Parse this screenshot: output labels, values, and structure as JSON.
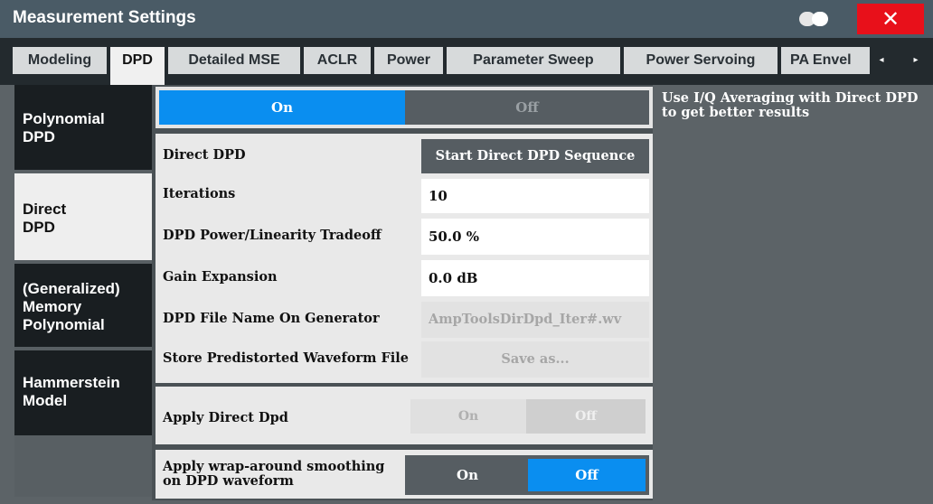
{
  "window": {
    "title": "Measurement Settings",
    "close_label": "✕",
    "toggle_icon": "display-toggle-icon"
  },
  "tabs": [
    {
      "label": "Modeling",
      "active": false
    },
    {
      "label": "DPD",
      "active": true
    },
    {
      "label": "Detailed MSE",
      "active": false
    },
    {
      "label": "ACLR",
      "active": false
    },
    {
      "label": "Power",
      "active": false
    },
    {
      "label": "Parameter Sweep",
      "active": false
    },
    {
      "label": "Power Servoing",
      "active": false
    },
    {
      "label": "PA Envel",
      "active": false
    }
  ],
  "tab_scroll": {
    "left": "◂",
    "right": "▸"
  },
  "side_tabs": [
    {
      "label": "Polynomial DPD",
      "active": false
    },
    {
      "label": "Direct DPD",
      "active": true
    },
    {
      "label": "(Generalized) Memory Polynomial",
      "active": false
    },
    {
      "label": "Hammerstein Model",
      "active": false
    }
  ],
  "state_toggle": {
    "on_label": "On",
    "off_label": "Off",
    "selected": "On"
  },
  "hint": "Use I/Q Averaging with Direct DPD to get better results",
  "settings": {
    "direct_dpd_label": "Direct DPD",
    "start_sequence_button": "Start Direct DPD Sequence",
    "iterations_label": "Iterations",
    "iterations_value": "10",
    "tradeoff_label": "DPD Power/Linearity Tradeoff",
    "tradeoff_value": "50.0 %",
    "gain_expansion_label": "Gain Expansion",
    "gain_expansion_value": "0.0 dB",
    "file_name_label": "DPD File Name On Generator",
    "file_name_value": "AmpToolsDirDpd_Iter#.wv",
    "store_label": "Store Predistorted Waveform File",
    "save_as_button": "Save as..."
  },
  "apply_direct": {
    "label": "Apply Direct Dpd",
    "on_label": "On",
    "off_label": "Off",
    "selected": "none"
  },
  "wrap_smoothing": {
    "label_line1": "Apply wrap-around smoothing",
    "label_line2": "on DPD waveform",
    "on_label": "On",
    "off_label": "Off",
    "selected": "Off"
  },
  "colors": {
    "accent": "#0a8ef0",
    "titlebar": "#4a5b66",
    "close": "#e8101a"
  }
}
